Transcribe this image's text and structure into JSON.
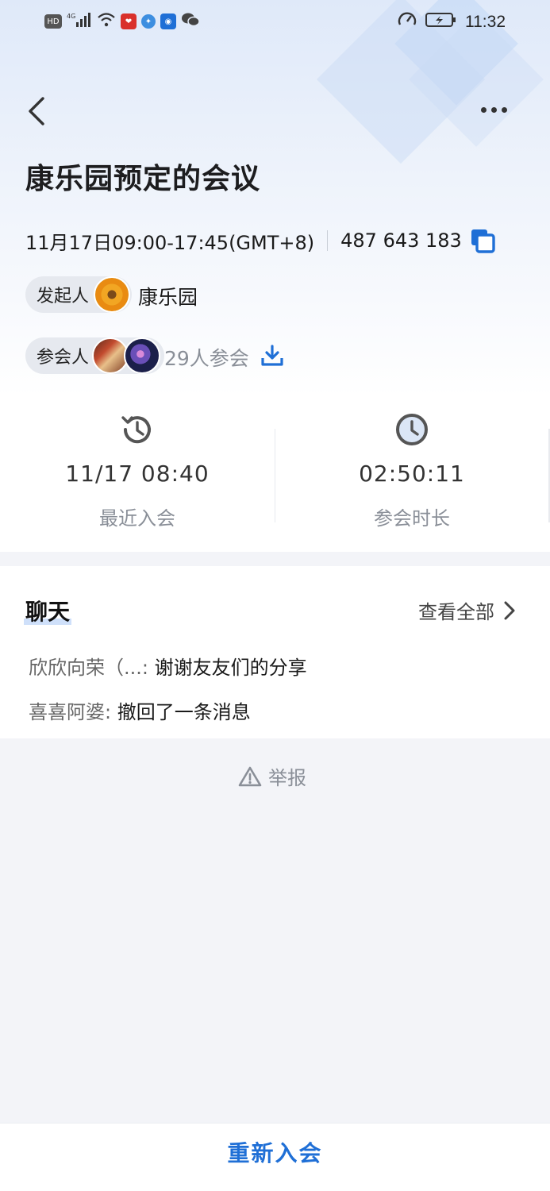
{
  "status_bar": {
    "time": "11:32",
    "left_icons": [
      "hd-icon",
      "4g-signal-icon",
      "wifi-icon",
      "app-notification-icon",
      "browser-icon",
      "bulb-app-icon",
      "wechat-icon"
    ],
    "right_icons": [
      "speed-icon",
      "battery-icon"
    ]
  },
  "header": {
    "title": "康乐园预定的会议"
  },
  "meeting": {
    "time_range": "11月17日09:00-17:45(GMT+8)",
    "meeting_id": "487 643 183",
    "host_label": "发起人",
    "host_name": "康乐园",
    "participants_label": "参会人",
    "participants_count": "29人参会"
  },
  "stats": {
    "last_join_value": "11/17 08:40",
    "last_join_label": "最近入会",
    "duration_value": "02:50:11",
    "duration_label": "参会时长"
  },
  "chat": {
    "title": "聊天",
    "view_all": "查看全部",
    "messages": [
      {
        "sender": "欣欣向荣（...:",
        "text": "谢谢友友们的分享"
      },
      {
        "sender": "喜喜阿婆:",
        "text": "撤回了一条消息"
      }
    ]
  },
  "report_label": "举报",
  "rejoin_label": "重新入会",
  "colors": {
    "accent": "#1f6fd6",
    "page_bg": "#f3f4f8",
    "muted_text": "#8a8f98"
  }
}
